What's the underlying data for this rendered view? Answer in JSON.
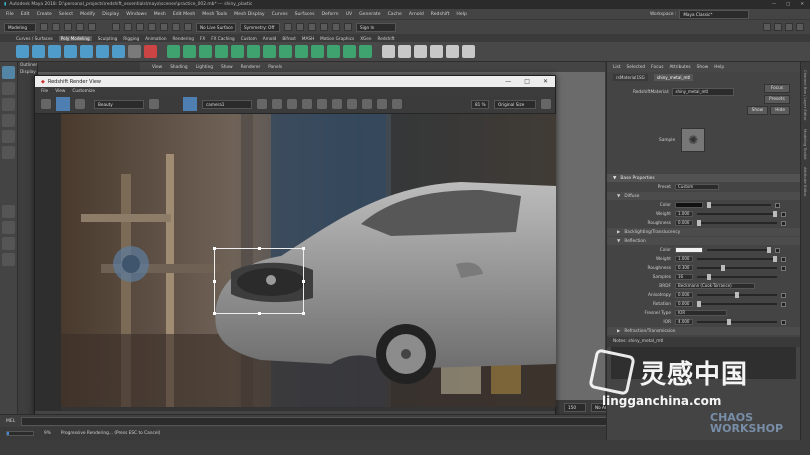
{
  "window_title": "Autodesk Maya 2018: D:\\personal_projects\\redshift_essentials\\maya\\scenes\\practice_002.mb* --- shiny_plastic",
  "menubar": [
    "File",
    "Edit",
    "Create",
    "Select",
    "Modify",
    "Display",
    "Windows",
    "Mesh",
    "Edit Mesh",
    "Mesh Tools",
    "Mesh Display",
    "Curves",
    "Surfaces",
    "Deform",
    "UV",
    "Generate",
    "Cache",
    "Arnold",
    "Redshift",
    "Help"
  ],
  "workspace": {
    "label": "Workspace :",
    "value": "Maya Classic*"
  },
  "status_line": {
    "mode": "Modeling",
    "surface": "No Live Surface",
    "symmetry": "Symmetry: Off",
    "sign_in": "Sign In"
  },
  "shelf_tabs": [
    "Curves / Surfaces",
    "Poly Modeling",
    "Sculpting",
    "Rigging",
    "Animation",
    "Rendering",
    "FX",
    "FX Caching",
    "Custom",
    "Arnold",
    "Bifrost",
    "MASH",
    "Motion Graphics",
    "XGen",
    "Redshift"
  ],
  "shelf_active": "Poly Modeling",
  "outliner": {
    "title": "Outliner",
    "display": "Display"
  },
  "viewport_menu": [
    "View",
    "Shading",
    "Lighting",
    "Show",
    "Renderer",
    "Panels"
  ],
  "render_view": {
    "title": "Redshift Render View",
    "menu": [
      "File",
      "View",
      "Customize"
    ],
    "aov": "Beauty",
    "camera": "camera1",
    "zoom": "81 %",
    "size_mode": "Original Size",
    "status": "Progressive Rendering...",
    "progress_label": "9%",
    "progress": 0.09
  },
  "timeline": {
    "frame": "150",
    "no_anim_layer": "No Anim Layer",
    "no_char_set": "No Character Set",
    "fps": "24 fps"
  },
  "command_line": {
    "lang": "MEL",
    "progress": "9%",
    "message": "Progressive Rendering... (Press ESC to Cancel)"
  },
  "attr_editor": {
    "menu": [
      "List",
      "Selected",
      "Focus",
      "Attributes",
      "Show",
      "Help"
    ],
    "tabs": [
      "rsMaterial1SG",
      "shiny_metal_mtl"
    ],
    "material_label": "RedshiftMaterial:",
    "material_name": "shiny_metal_mtl",
    "buttons": {
      "focus": "Focus",
      "presets": "Presets",
      "show": "Show",
      "hide": "Hide"
    },
    "sample": "Sample",
    "base_properties": "Base Properties",
    "preset": {
      "label": "Preset",
      "value": "Custom"
    },
    "diffuse": {
      "title": "Diffuse",
      "color": "Color",
      "weight": "Weight",
      "weight_val": "1.000",
      "roughness": "Roughness",
      "roughness_val": "0.000"
    },
    "backlighting": "Backlighting/Translucency",
    "reflection": {
      "title": "Reflection",
      "color": "Color",
      "weight": "Weight",
      "weight_val": "1.000",
      "roughness": "Roughness",
      "roughness_val": "0.300",
      "samples": "Samples",
      "samples_val": "16",
      "brdf": "BRDF",
      "brdf_val": "Beckmann (Cook-Torrance)",
      "anisotropy": "Anisotropy",
      "anisotropy_val": "0.000",
      "rotation": "Rotation",
      "rotation_val": "0.000",
      "fresnel": "Fresnel Type",
      "fresnel_val": "IOR",
      "ior": "IOR",
      "ior_val": "4.000"
    },
    "refraction": "Refraction/Transmission",
    "notes": "Notes: shiny_metal_mtl"
  },
  "side_tabs": [
    "Channel Box / Layer Editor",
    "Modeling Toolkit",
    "Attribute Editor"
  ],
  "watermark": {
    "cn": "灵感中国",
    "url": "lingganchina.com",
    "brand": "CHAOS WORKSHOP"
  },
  "colors": {
    "accent": "#5285a6",
    "render_blue": "#4f7fb0",
    "progress": "#3e8bd6"
  }
}
